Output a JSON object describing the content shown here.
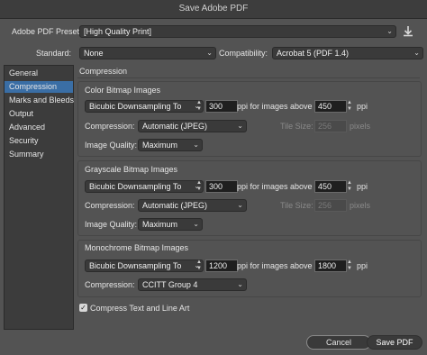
{
  "window": {
    "title": "Save Adobe PDF"
  },
  "top": {
    "preset_label": "Adobe PDF Preset:",
    "preset_value": "[High Quality Print]",
    "standard_label": "Standard:",
    "standard_value": "None",
    "compat_label": "Compatibility:",
    "compat_value": "Acrobat 5 (PDF 1.4)"
  },
  "sidebar": {
    "items": [
      {
        "label": "General"
      },
      {
        "label": "Compression"
      },
      {
        "label": "Marks and Bleeds"
      },
      {
        "label": "Output"
      },
      {
        "label": "Advanced"
      },
      {
        "label": "Security"
      },
      {
        "label": "Summary"
      }
    ],
    "selected": "Compression"
  },
  "main": {
    "section_title": "Compression",
    "color": {
      "title": "Color Bitmap Images",
      "downsample_value": "Bicubic Downsampling To",
      "ppi_value": "300",
      "ppi_for_label": "ppi for images above",
      "above_value": "450",
      "ppi_unit": "ppi",
      "compression_label": "Compression:",
      "compression_value": "Automatic (JPEG)",
      "tile_label": "Tile Size:",
      "tile_value": "256",
      "pixels_label": "pixels",
      "quality_label": "Image Quality:",
      "quality_value": "Maximum"
    },
    "gray": {
      "title": "Grayscale Bitmap Images",
      "downsample_value": "Bicubic Downsampling To",
      "ppi_value": "300",
      "ppi_for_label": "ppi for images above",
      "above_value": "450",
      "ppi_unit": "ppi",
      "compression_label": "Compression:",
      "compression_value": "Automatic (JPEG)",
      "tile_label": "Tile Size:",
      "tile_value": "256",
      "pixels_label": "pixels",
      "quality_label": "Image Quality:",
      "quality_value": "Maximum"
    },
    "mono": {
      "title": "Monochrome Bitmap Images",
      "downsample_value": "Bicubic Downsampling To",
      "ppi_value": "1200",
      "ppi_for_label": "ppi for images above",
      "above_value": "1800",
      "ppi_unit": "ppi",
      "compression_label": "Compression:",
      "compression_value": "CCITT Group 4"
    },
    "compress_text_label": "Compress Text and Line Art",
    "compress_text_checked": true
  },
  "buttons": {
    "cancel": "Cancel",
    "save": "Save PDF"
  },
  "icons": {
    "save_preset": "download-icon",
    "chevron": "chevron-updown-icon",
    "check": "checkmark-icon"
  },
  "colors": {
    "selection": "#3a6ea5",
    "background": "#535353"
  }
}
